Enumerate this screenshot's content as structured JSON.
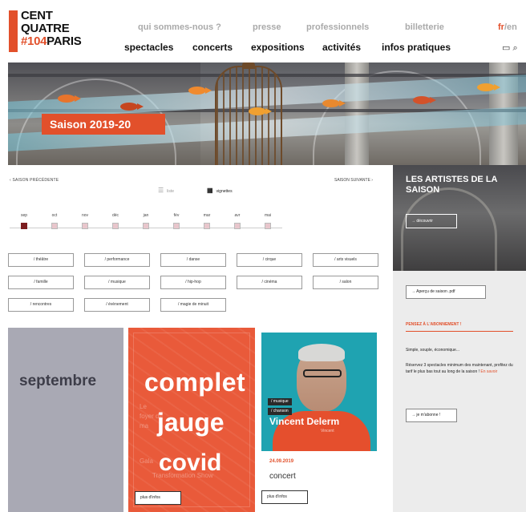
{
  "header": {
    "logo": {
      "line1": "CENT",
      "line2": "QUATRE",
      "line3_hash": "#104",
      "line3_rest": "PARIS"
    },
    "top_nav": [
      {
        "label": "qui sommes-nous ?"
      },
      {
        "label": "presse"
      },
      {
        "label": "professionnels"
      },
      {
        "label": "billetterie"
      }
    ],
    "lang": {
      "fr": "fr",
      "sep": "/",
      "en": "en"
    },
    "main_nav": [
      {
        "label": "spectacles"
      },
      {
        "label": "concerts"
      },
      {
        "label": "expositions"
      },
      {
        "label": "activités"
      },
      {
        "label": "infos pratiques"
      }
    ]
  },
  "hero": {
    "badge": "Saison 2019-20"
  },
  "calendar": {
    "prev_label": "SAISON PRÉCÉDENTE",
    "next_label": "SAISON SUIVANTE",
    "view_list_label": "liste",
    "view_grid_label": "vignettes",
    "months": [
      "sep",
      "oct",
      "nov",
      "déc",
      "jan",
      "fév",
      "mar",
      "avr",
      "mai"
    ],
    "active_month": "sep",
    "filters": [
      "/ théâtre",
      "/ performance",
      "/ danse",
      "/ cirque",
      "/ arts visuels",
      "/ famille",
      "/ musique",
      "/ hip-hop",
      "/ cinéma",
      "/ salon",
      "/ rencontres",
      "/ évènement",
      "/ magie de minuit"
    ]
  },
  "sidebar": {
    "artists_title": "LES ARTISTES DE LA SAISON",
    "artists_button": "découvrir",
    "apercu_button": "Aperçu de saison .pdf",
    "abo_title": "PENSEZ À L'ABONNEMENT !",
    "abo_sub": "Simple, souple, économique...",
    "abo_text": "Réservez 3 spectacles minimum des maintenant, profitez du tarif le plus bas tout au long de la saison ! ",
    "abo_link": "En savoir",
    "abo_button": "je m'abonne !"
  },
  "cards": {
    "month_label": "septembre",
    "show": {
      "words": [
        "complet",
        "jauge",
        "covid"
      ],
      "ghost": [
        "Le",
        "foyer de",
        "ma",
        "Gala",
        "Transformation Show"
      ],
      "more": "plus d'infos"
    },
    "artist": {
      "tags": [
        "/ musique",
        "/ chanson"
      ],
      "name": "Vincent Delerm",
      "subtitle": "Vincent",
      "date": "24.09.2019",
      "type": "concert",
      "more": "plus d'infos"
    }
  },
  "colors": {
    "accent": "#e2502b",
    "active_month": "#7b1c1f",
    "artist_card": "#1fa3b1",
    "month_card": "#a9a9b4"
  }
}
